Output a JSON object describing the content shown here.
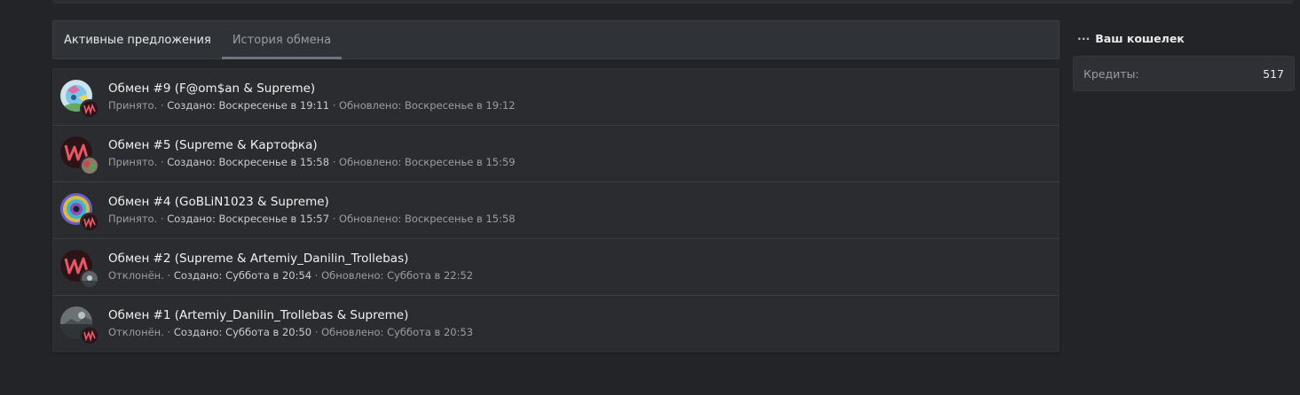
{
  "tabs": {
    "active_offers": "Активные предложения",
    "history": "История обмена"
  },
  "trades": [
    {
      "title": "Обмен #9 (F@om$an & Supreme)",
      "status": "Принято.",
      "created": "Создано: Воскресенье в 19:11",
      "updated": "Обновлено: Воскресенье в 19:12"
    },
    {
      "title": "Обмен #5 (Supreme & Картофка)",
      "status": "Принято.",
      "created": "Создано: Воскресенье в 15:58",
      "updated": "Обновлено: Воскресенье в 15:59"
    },
    {
      "title": "Обмен #4 (GoBLiN1023 & Supreme)",
      "status": "Принято.",
      "created": "Создано: Воскресенье в 15:57",
      "updated": "Обновлено: Воскресенье в 15:58"
    },
    {
      "title": "Обмен #2 (Supreme & Artemiy_Danilin_Trollebas)",
      "status": "Отклонён.",
      "created": "Создано: Суббота в 20:54",
      "updated": "Обновлено: Суббота в 22:52"
    },
    {
      "title": "Обмен #1 (Artemiy_Danilin_Trollebas & Supreme)",
      "status": "Отклонён.",
      "created": "Создано: Суббота в 20:50",
      "updated": "Обновлено: Суббота в 20:53"
    }
  ],
  "separator": " · ",
  "wallet": {
    "dots": "···",
    "title": "Ваш кошелек",
    "credits_label": "Кредиты:",
    "credits_value": "517"
  },
  "colors": {
    "background": "#232427",
    "panel": "#2a2c30",
    "tab_bar": "#2f3237",
    "accent_underline": "#6e7580"
  }
}
